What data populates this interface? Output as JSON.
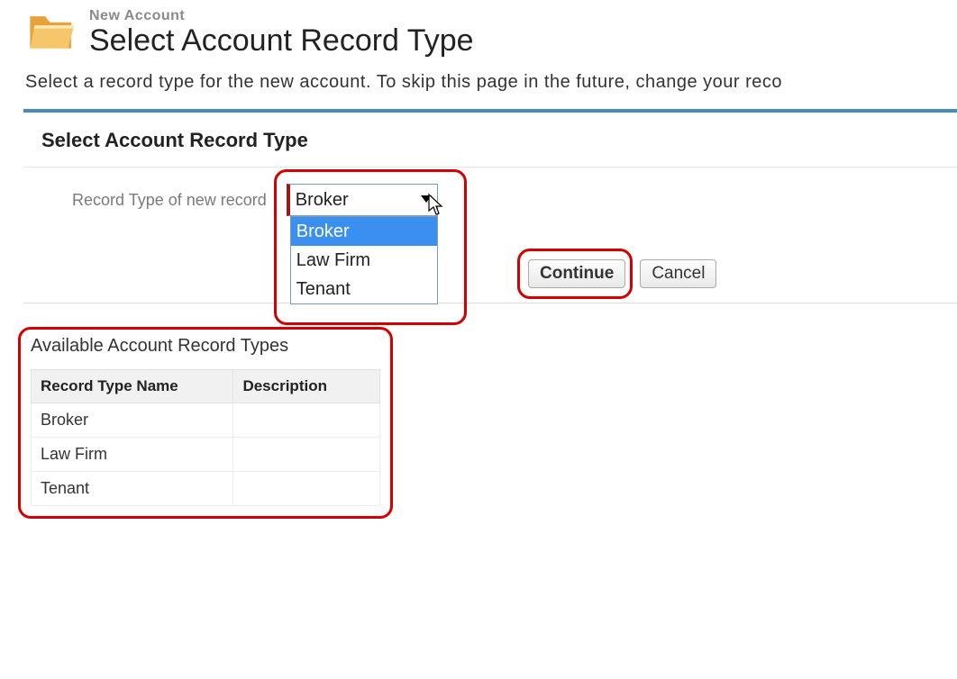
{
  "header": {
    "breadcrumb": "New Account",
    "title": "Select Account Record Type"
  },
  "instructions": "Select a record type for the new account. To skip this page in the future, change your reco",
  "panel": {
    "heading": "Select Account Record Type",
    "field_label": "Record Type of new record",
    "select": {
      "value": "Broker",
      "options": [
        "Broker",
        "Law Firm",
        "Tenant"
      ],
      "highlighted": "Broker"
    },
    "buttons": {
      "continue": "Continue",
      "cancel": "Cancel"
    }
  },
  "available": {
    "heading": "Available Account Record Types",
    "columns": [
      "Record Type Name",
      "Description"
    ],
    "rows": [
      {
        "name": "Broker",
        "description": ""
      },
      {
        "name": "Law Firm",
        "description": ""
      },
      {
        "name": "Tenant",
        "description": ""
      }
    ]
  }
}
